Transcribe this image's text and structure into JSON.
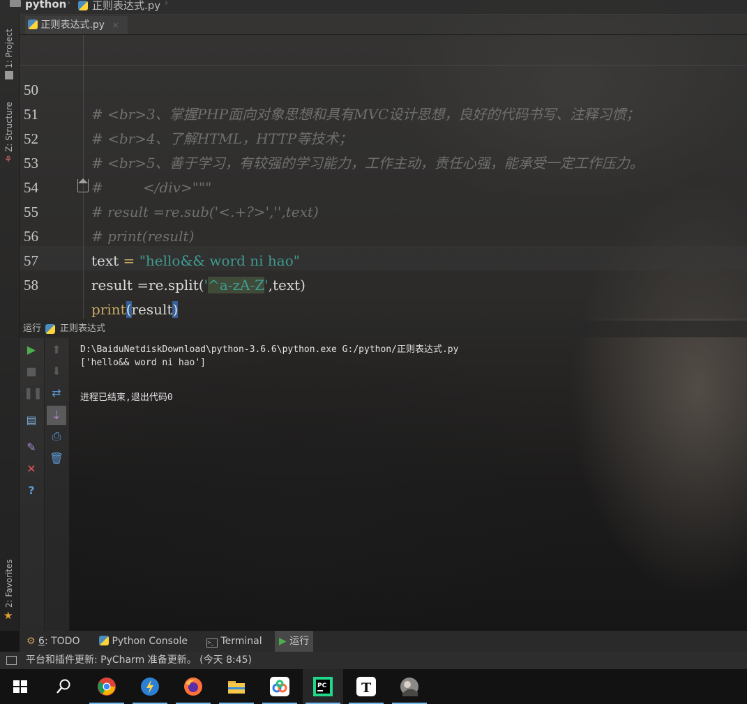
{
  "breadcrumb": {
    "project": "python",
    "file": "正则表达式.py"
  },
  "editor_tab": {
    "label": "正则表达式.py",
    "close": "×"
  },
  "left_strip": {
    "project": "1: Project",
    "structure": "Z: Structure",
    "favorites": "2: Favorites"
  },
  "editor": {
    "lines": [
      {
        "num": "50",
        "code": "# <br>3、掌握PHP面向对象思想和具有MVC设计思想，良好的代码书写、注释习惯；"
      },
      {
        "num": "51",
        "code": "# <br>4、了解HTML，HTTP等技术；"
      },
      {
        "num": "52",
        "code": "# <br>5、善于学习，有较强的学习能力，工作主动，责任心强，能承受一定工作压力。"
      },
      {
        "num": "53",
        "code": "#         </div>\"\"\""
      },
      {
        "num": "54",
        "code": "# result =re.sub('<.+?>','',text)"
      },
      {
        "num": "55",
        "code": "# print(result)"
      },
      {
        "num": "56",
        "var": "text",
        "op": " = ",
        "str": "\"hello&& word ni hao\""
      },
      {
        "num": "57",
        "pre": "result =re.split(",
        "q1": "'",
        "regex": "^a-zA-Z",
        "q2": "'",
        "post": ",text)"
      },
      {
        "num": "58",
        "kw": "print",
        "open": "(",
        "arg": "result",
        "close": ")"
      }
    ]
  },
  "run_panel": {
    "label": "运行",
    "config": "正则表达式",
    "output": [
      "D:\\BaiduNetdiskDownload\\python-3.6.6\\python.exe G:/python/正则表达式.py",
      "['hello&& word ni hao']",
      "",
      "进程已结束,退出代码0"
    ]
  },
  "tool_tabs": {
    "todo_num": "6",
    "todo": ": TODO",
    "python_console": "Python Console",
    "terminal": "Terminal",
    "run": "运行"
  },
  "status": {
    "message": "平台和插件更新: PyCharm 准备更新。 (今天 8:45)"
  },
  "colors": {
    "comment": "#6f6f6f",
    "string": "#3f9c90",
    "keyword": "#c9ae66",
    "brace": "#3b73b9",
    "run_green": "#4cae4c",
    "stop_red": "#e05555"
  }
}
